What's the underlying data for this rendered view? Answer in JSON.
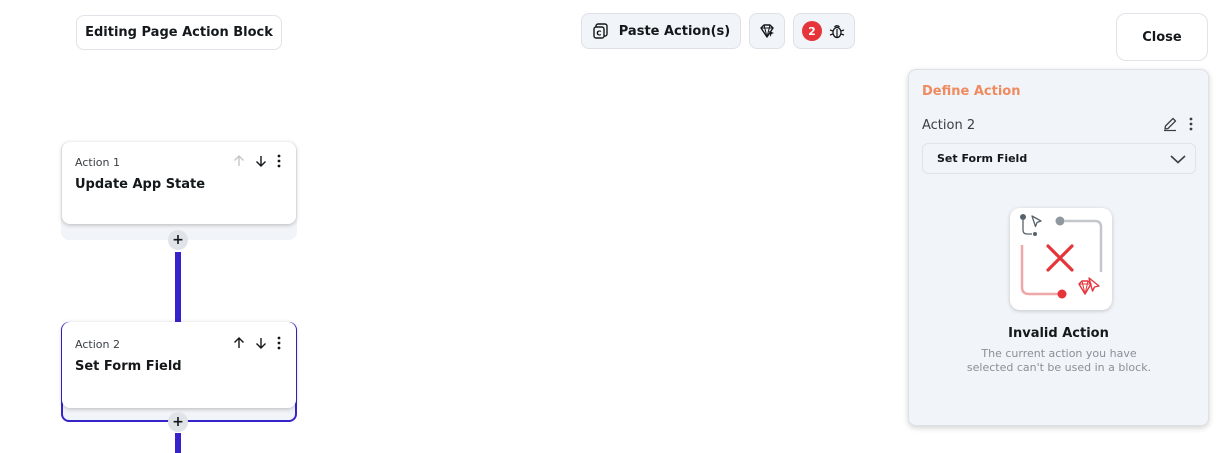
{
  "header": {
    "title": "Editing Page Action Block",
    "paste_label": "Paste Action(s)",
    "debug_count": "2",
    "close_label": "Close"
  },
  "actions": [
    {
      "number": "Action 1",
      "name": "Update App State"
    },
    {
      "number": "Action 2",
      "name": "Set Form Field"
    }
  ],
  "panel": {
    "title": "Define Action",
    "action_name": "Action 2",
    "selected_action": "Set Form Field",
    "invalid_title": "Invalid Action",
    "invalid_desc": "The current action you have selected can't be used in a block."
  },
  "colors": {
    "accent": "#3623c9",
    "panel_title": "#ee8b60",
    "error": "#e5353b"
  }
}
